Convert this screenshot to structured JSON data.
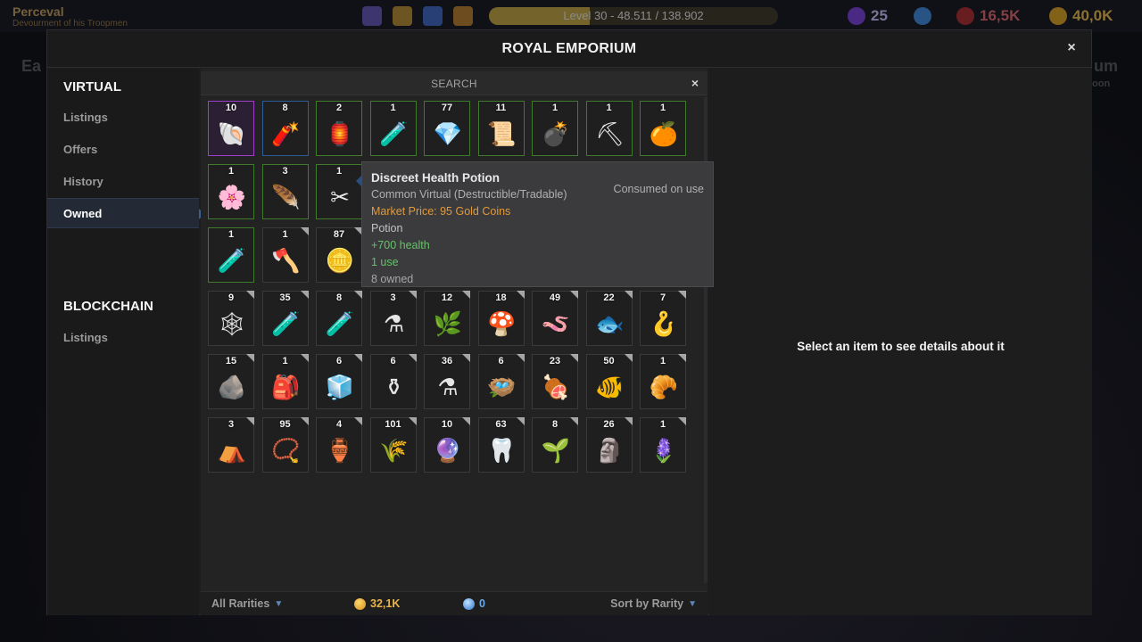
{
  "hud": {
    "player_name": "Perceval",
    "player_subtitle": "Devourment of his Troopmen",
    "level_text": "Level 30 - 48.511 / 138.902",
    "level_progress": 0.35,
    "gems": "25",
    "power": "16,5K",
    "gold": "40,0K",
    "bg_left_text": "Ea",
    "bg_right_text": "um",
    "bg_right_sub": "oon"
  },
  "window": {
    "title": "ROYAL EMPORIUM",
    "close": "×"
  },
  "sidebar": {
    "virtual_header": "VIRTUAL",
    "virtual_items": [
      "Listings",
      "Offers",
      "History",
      "Owned"
    ],
    "active_item": "Owned",
    "blockchain_header": "BLOCKCHAIN",
    "blockchain_items": [
      "Listings"
    ]
  },
  "search": {
    "label": "SEARCH",
    "close": "×"
  },
  "inventory": {
    "items": [
      {
        "qty": "10",
        "icon": "compass-shell-icon",
        "glyph": "🐚",
        "rarity": "purple"
      },
      {
        "qty": "8",
        "icon": "dynamite-clock-icon",
        "glyph": "🧨",
        "rarity": "blue"
      },
      {
        "qty": "2",
        "icon": "lantern-trap-icon",
        "glyph": "🏮",
        "rarity": "green"
      },
      {
        "qty": "1",
        "icon": "green-potion-icon",
        "glyph": "🧪",
        "rarity": "green"
      },
      {
        "qty": "77",
        "icon": "blue-crystal-icon",
        "glyph": "💎",
        "rarity": "green"
      },
      {
        "qty": "11",
        "icon": "scroll-icon",
        "glyph": "📜",
        "rarity": "green"
      },
      {
        "qty": "1",
        "icon": "spiked-bomb-icon",
        "glyph": "💣",
        "rarity": "green"
      },
      {
        "qty": "1",
        "icon": "pickaxe-icon",
        "glyph": "⛏",
        "rarity": "green"
      },
      {
        "qty": "1",
        "icon": "orange-potion-icon",
        "glyph": "🍊",
        "rarity": "green"
      },
      {
        "qty": "1",
        "icon": "purple-flowers-icon",
        "glyph": "🌸",
        "rarity": "green"
      },
      {
        "qty": "3",
        "icon": "feather-icon",
        "glyph": "🪶",
        "rarity": "green"
      },
      {
        "qty": "1",
        "icon": "scissors-icon",
        "glyph": "✂",
        "rarity": "green"
      },
      {
        "qty": "",
        "icon": "hidden-slot-icon",
        "glyph": "",
        "rarity": "gray"
      },
      {
        "qty": "",
        "icon": "hidden-slot-icon",
        "glyph": "",
        "rarity": "gray"
      },
      {
        "qty": "",
        "icon": "hidden-slot-icon",
        "glyph": "",
        "rarity": "gray"
      },
      {
        "qty": "",
        "icon": "hidden-slot-icon",
        "glyph": "",
        "rarity": "gray"
      },
      {
        "qty": "",
        "icon": "hidden-slot-icon",
        "glyph": "",
        "rarity": "gray"
      },
      {
        "qty": "",
        "icon": "hidden-slot-icon",
        "glyph": "",
        "rarity": "gray"
      },
      {
        "qty": "1",
        "icon": "health-potion-icon",
        "glyph": "🧪",
        "rarity": "green"
      },
      {
        "qty": "1",
        "icon": "axe-icon",
        "glyph": "🪓",
        "rarity": "gray"
      },
      {
        "qty": "87",
        "icon": "gold-ore-icon",
        "glyph": "🪙",
        "rarity": "gray"
      },
      {
        "qty": "",
        "icon": "hidden-slot-icon",
        "glyph": "",
        "rarity": "gray"
      },
      {
        "qty": "",
        "icon": "hidden-slot-icon",
        "glyph": "",
        "rarity": "gray"
      },
      {
        "qty": "",
        "icon": "hidden-slot-icon",
        "glyph": "",
        "rarity": "gray"
      },
      {
        "qty": "",
        "icon": "hidden-slot-icon",
        "glyph": "",
        "rarity": "gray"
      },
      {
        "qty": "",
        "icon": "hidden-slot-icon",
        "glyph": "",
        "rarity": "gray"
      },
      {
        "qty": "",
        "icon": "hidden-slot-icon",
        "glyph": "",
        "rarity": "gray"
      },
      {
        "qty": "9",
        "icon": "spider-web-icon",
        "glyph": "🕸",
        "rarity": "gray"
      },
      {
        "qty": "35",
        "icon": "blue-vial-icon",
        "glyph": "🧪",
        "rarity": "gray"
      },
      {
        "qty": "8",
        "icon": "green-vial-icon",
        "glyph": "🧪",
        "rarity": "gray"
      },
      {
        "qty": "3",
        "icon": "empty-flask-icon",
        "glyph": "⚗",
        "rarity": "gray"
      },
      {
        "qty": "12",
        "icon": "herb-icon",
        "glyph": "🌿",
        "rarity": "gray"
      },
      {
        "qty": "18",
        "icon": "mushroom-icon",
        "glyph": "🍄",
        "rarity": "gray"
      },
      {
        "qty": "49",
        "icon": "worms-icon",
        "glyph": "🪱",
        "rarity": "gray"
      },
      {
        "qty": "22",
        "icon": "fish-icon",
        "glyph": "🐟",
        "rarity": "gray"
      },
      {
        "qty": "7",
        "icon": "hook-worm-icon",
        "glyph": "🪝",
        "rarity": "gray"
      },
      {
        "qty": "15",
        "icon": "stone-icon",
        "glyph": "🪨",
        "rarity": "gray"
      },
      {
        "qty": "1",
        "icon": "red-bag-icon",
        "glyph": "🎒",
        "rarity": "gray"
      },
      {
        "qty": "6",
        "icon": "glass-box-icon",
        "glyph": "🧊",
        "rarity": "gray"
      },
      {
        "qty": "6",
        "icon": "black-flask-icon",
        "glyph": "⚱",
        "rarity": "gray"
      },
      {
        "qty": "36",
        "icon": "ring-flask-icon",
        "glyph": "⚗",
        "rarity": "gray"
      },
      {
        "qty": "6",
        "icon": "bird-nest-icon",
        "glyph": "🪺",
        "rarity": "gray"
      },
      {
        "qty": "23",
        "icon": "ham-icon",
        "glyph": "🍖",
        "rarity": "gray"
      },
      {
        "qty": "50",
        "icon": "raw-fish-icon",
        "glyph": "🐠",
        "rarity": "gray"
      },
      {
        "qty": "1",
        "icon": "croissant-icon",
        "glyph": "🥐",
        "rarity": "gray"
      },
      {
        "qty": "3",
        "icon": "blue-tent-icon",
        "glyph": "⛺",
        "rarity": "gray"
      },
      {
        "qty": "95",
        "icon": "pearl-string-icon",
        "glyph": "📿",
        "rarity": "gray"
      },
      {
        "qty": "4",
        "icon": "spilled-jar-icon",
        "glyph": "🏺",
        "rarity": "gray"
      },
      {
        "qty": "101",
        "icon": "green-sprig-icon",
        "glyph": "🌾",
        "rarity": "gray"
      },
      {
        "qty": "10",
        "icon": "purple-shard-icon",
        "glyph": "🔮",
        "rarity": "gray"
      },
      {
        "qty": "63",
        "icon": "teeth-icon",
        "glyph": "🦷",
        "rarity": "gray"
      },
      {
        "qty": "8",
        "icon": "thorn-vine-icon",
        "glyph": "🌱",
        "rarity": "gray"
      },
      {
        "qty": "26",
        "icon": "stone-arch-icon",
        "glyph": "🗿",
        "rarity": "gray"
      },
      {
        "qty": "1",
        "icon": "lavender-icon",
        "glyph": "🪻",
        "rarity": "gray"
      }
    ]
  },
  "tooltip": {
    "name": "Discreet Health Potion",
    "type": "Common Virtual (Destructible/Tradable)",
    "consumed": "Consumed on use",
    "price": "Market Price: 95 Gold Coins",
    "category": "Potion",
    "effect": "+700 health",
    "uses": "1 use",
    "owned": "8 owned"
  },
  "details": {
    "placeholder": "Select an item to see details about it"
  },
  "footer": {
    "rarity_filter": "All Rarities",
    "gold": "32,1K",
    "gems": "0",
    "sort": "Sort by Rarity"
  },
  "colors": {
    "accent_blue": "#3b5f8a",
    "gold": "#e8b44a",
    "price_orange": "#e09a3a",
    "effect_green": "#67c06a"
  }
}
